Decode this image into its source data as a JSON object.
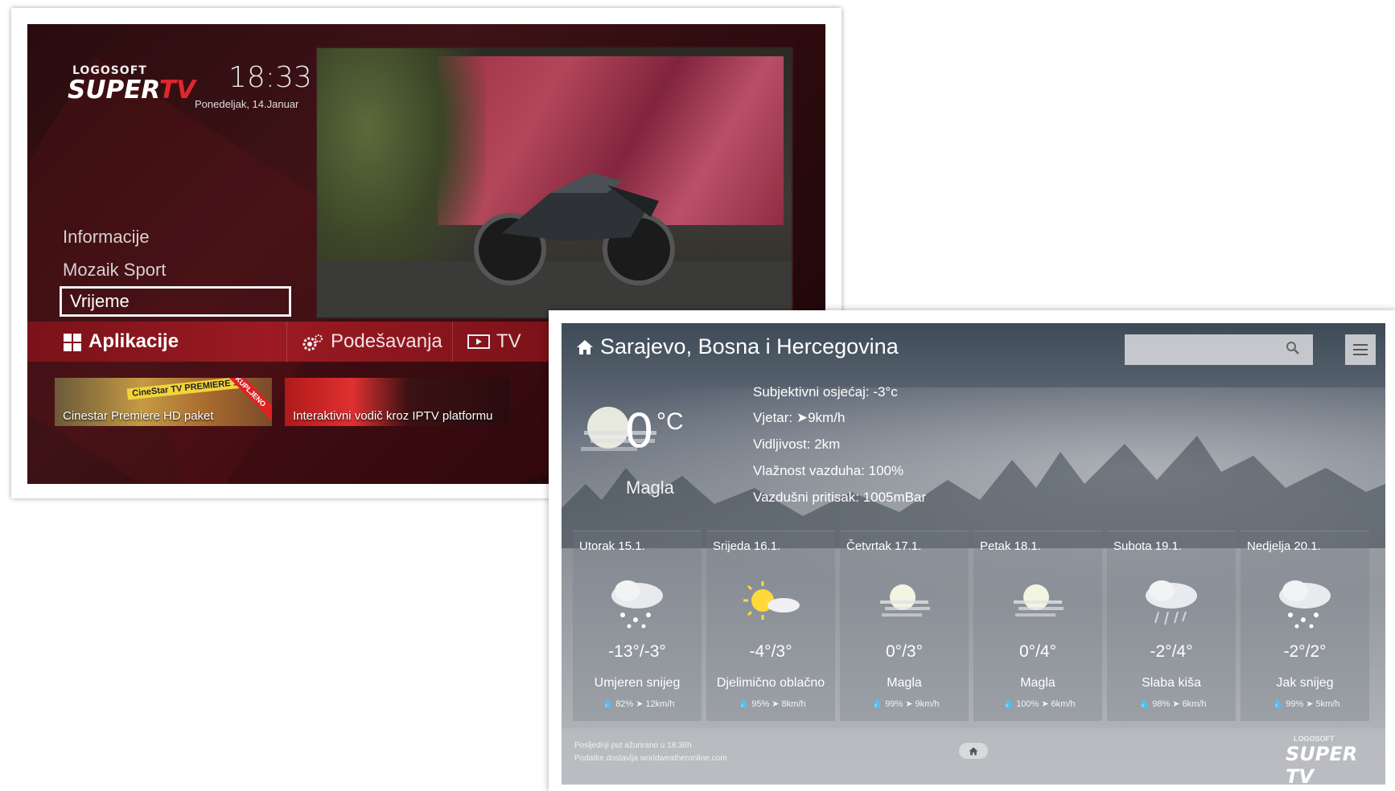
{
  "tv_menu": {
    "logo_top": "LOGOSOFT",
    "logo_main_a": "SUPER",
    "logo_main_b": "TV",
    "time": "18:33",
    "date": "Ponedeljak, 14.Januar",
    "menu_items": [
      "Informacije",
      "Mozaik Sport",
      "Vrijeme"
    ],
    "selected_item": "Vrijeme",
    "tabs": [
      {
        "label": "Aplikacije",
        "icon": "grid-icon"
      },
      {
        "label": "Podešavanja",
        "icon": "gear-icon"
      },
      {
        "label": "TV",
        "icon": "tv-icon"
      }
    ],
    "thumbnails": [
      {
        "label": "Cinestar Premiere HD paket",
        "badge": "CineStar TV PREMIERE 1",
        "ribbon": "KUPLJENO"
      },
      {
        "label": "Interaktivni vodič kroz IPTV platformu"
      }
    ]
  },
  "weather": {
    "location": "Sarajevo, Bosna i Hercegovina",
    "search_placeholder": "",
    "current": {
      "temp": "0",
      "unit": "°C",
      "condition": "Magla",
      "feels_like": "Subjektivni osjećaj: -3°c",
      "wind": "Vjetar: ➤9km/h",
      "visibility": "Vidljivost: 2km",
      "humidity": "Vlažnost vazduha: 100%",
      "pressure": "Vazdušni pritisak: 1005mBar"
    },
    "forecast": [
      {
        "day": "Utorak 15.1.",
        "temps": "-13°/-3°",
        "condition": "Umjeren snijeg",
        "humidity": "82%",
        "wind": "12km/h",
        "icon": "snow-cloud-icon"
      },
      {
        "day": "Srijeda 16.1.",
        "temps": "-4°/3°",
        "condition": "Djelimično oblačno",
        "humidity": "95%",
        "wind": "8km/h",
        "icon": "sun-cloud-icon"
      },
      {
        "day": "Četvrtak 17.1.",
        "temps": "0°/3°",
        "condition": "Magla",
        "humidity": "99%",
        "wind": "9km/h",
        "icon": "fog-sun-icon"
      },
      {
        "day": "Petak 18.1.",
        "temps": "0°/4°",
        "condition": "Magla",
        "humidity": "100%",
        "wind": "6km/h",
        "icon": "fog-sun-icon"
      },
      {
        "day": "Subota 19.1.",
        "temps": "-2°/4°",
        "condition": "Slaba kiša",
        "humidity": "98%",
        "wind": "6km/h",
        "icon": "rain-cloud-icon"
      },
      {
        "day": "Nedjelja 20.1.",
        "temps": "-2°/2°",
        "condition": "Jak snijeg",
        "humidity": "99%",
        "wind": "5km/h",
        "icon": "snow-cloud-icon"
      }
    ],
    "footer": {
      "updated": "Posljednji put ažurirano u 18:36h",
      "source": "Podatke dostavlja worldweatheronline.com",
      "brand_small": "LOGOSOFT",
      "brand": "SUPER TV"
    }
  },
  "colors": {
    "tv_bar": "#9c1a22",
    "tv_bg": "#2a0c0e",
    "logo_accent": "#e0262d"
  }
}
